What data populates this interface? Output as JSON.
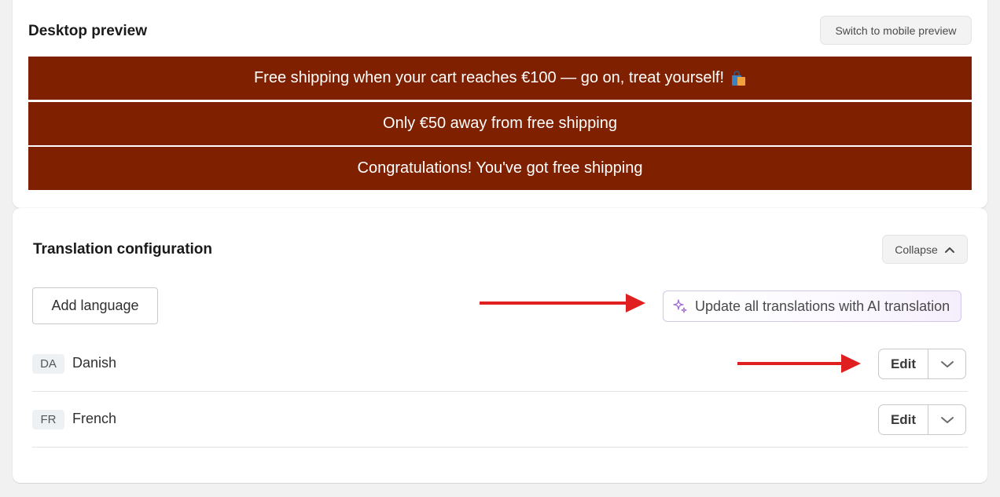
{
  "preview": {
    "title": "Desktop preview",
    "switch_label": "Switch to mobile preview",
    "bar_color": "#7f2100",
    "bars": [
      {
        "text": "Free shipping when your cart reaches €100 — go on, treat yourself!",
        "icon": "shopping-bag-icon"
      },
      {
        "text": "Only €50 away from free shipping"
      },
      {
        "text": "Congratulations! You've got free shipping"
      }
    ]
  },
  "translation": {
    "title": "Translation configuration",
    "collapse_label": "Collapse",
    "add_language_label": "Add language",
    "ai_update_label": "Update all translations with AI translation",
    "languages": [
      {
        "code": "DA",
        "name": "Danish",
        "edit_label": "Edit"
      },
      {
        "code": "FR",
        "name": "French",
        "edit_label": "Edit"
      }
    ]
  },
  "annotations": {
    "arrow_color": "#e02020"
  }
}
